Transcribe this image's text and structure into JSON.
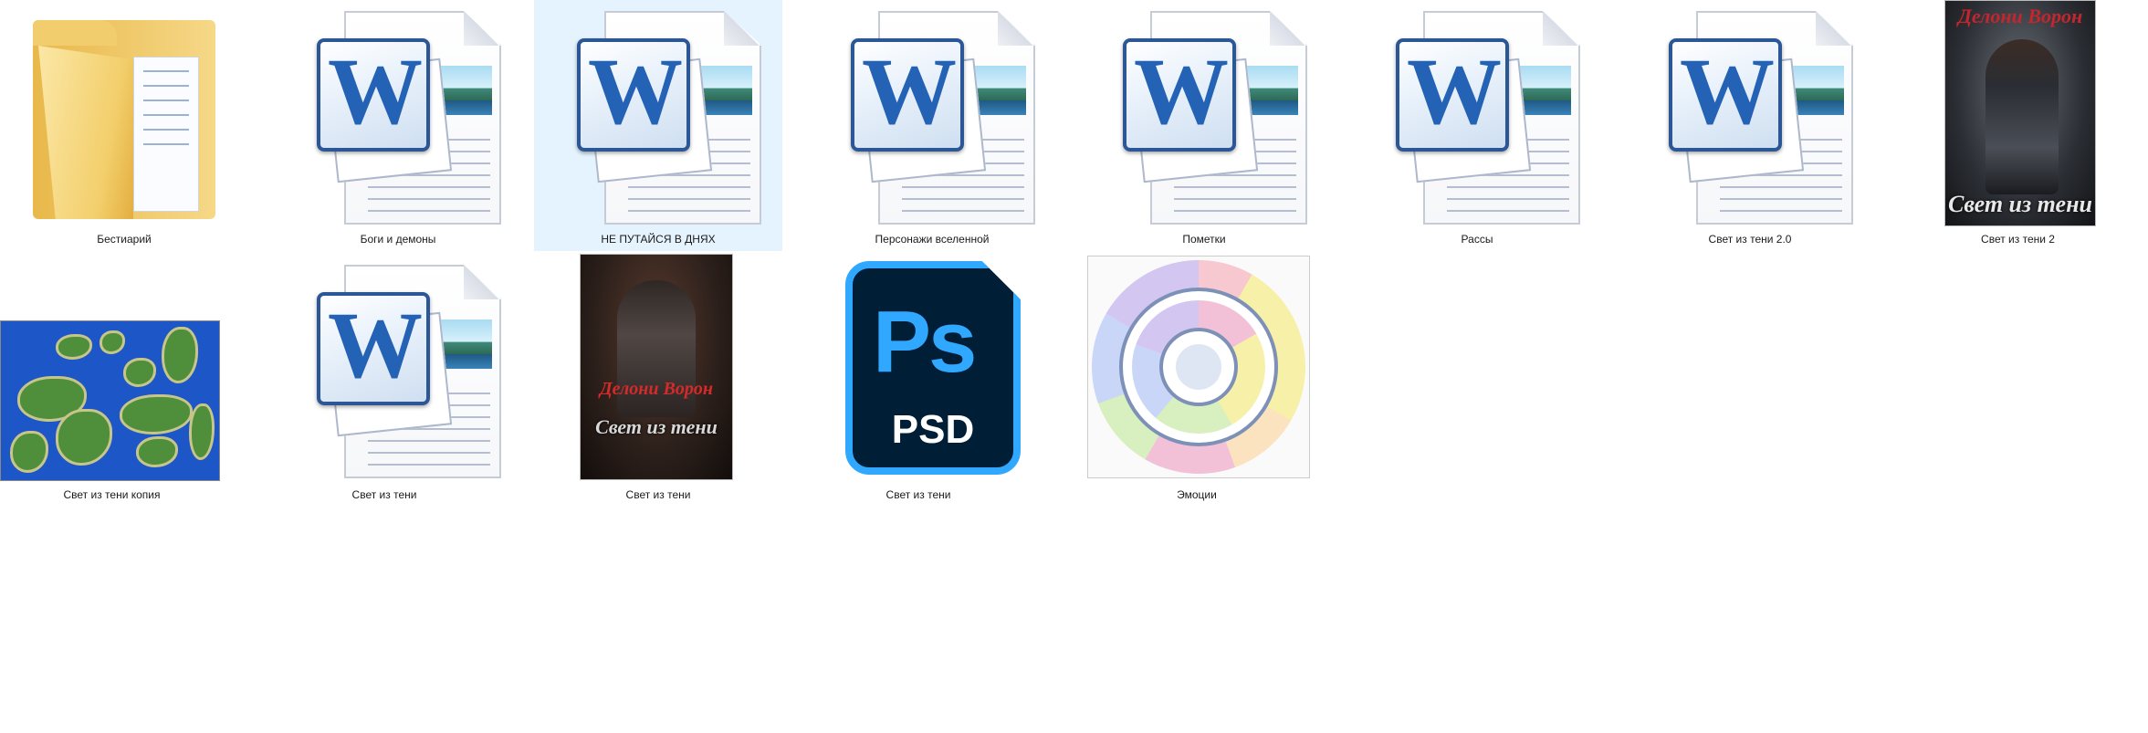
{
  "files": [
    {
      "name": "Бестиарий",
      "type": "folder",
      "selected": false
    },
    {
      "name": "Боги и демоны",
      "type": "word",
      "selected": false
    },
    {
      "name": "НЕ ПУТАЙСЯ В ДНЯХ",
      "type": "word",
      "selected": true
    },
    {
      "name": "Персонажи вселенной",
      "type": "word",
      "selected": false
    },
    {
      "name": "Пометки",
      "type": "word",
      "selected": false
    },
    {
      "name": "Рассы",
      "type": "word",
      "selected": false
    },
    {
      "name": "Свет из тени 2.0",
      "type": "word",
      "selected": false
    },
    {
      "name": "Свет из тени 2",
      "type": "image-cover",
      "selected": false
    },
    {
      "name": "Свет из тени копия",
      "type": "image-map",
      "selected": false
    },
    {
      "name": "Свет из тени",
      "type": "word",
      "selected": false
    },
    {
      "name": "Свет из тени",
      "type": "image-cover",
      "selected": false
    },
    {
      "name": "Свет из тени",
      "type": "psd",
      "selected": false
    },
    {
      "name": "Эмоции",
      "type": "image-wheel",
      "selected": false
    }
  ],
  "thumb_text": {
    "word_letter": "W",
    "cover1_author": "Делони Ворон",
    "cover1_title": "Свет из тени",
    "cover2_author": "Делони Ворон",
    "cover2_title": "Свет из тени",
    "psd_logo": "Ps",
    "psd_ext": "PSD"
  },
  "colors": {
    "selection": "#e5f3ff",
    "word_blue": "#2462b5",
    "psd_blue": "#31a8ff",
    "psd_bg": "#001e36",
    "folder_yellow": "#f3cf6c"
  }
}
